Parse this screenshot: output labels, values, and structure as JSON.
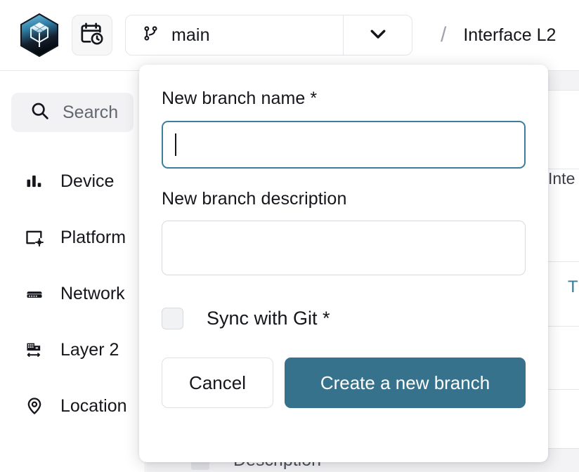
{
  "topbar": {
    "logo_icon": "app-logo-hexagon-cube",
    "history_button_icon": "calendar-clock-icon",
    "branch": {
      "icon": "git-branch-icon",
      "name": "main",
      "caret_icon": "chevron-down-icon"
    },
    "breadcrumb_separator": "/",
    "breadcrumb_title": "Interface L2"
  },
  "sidebar": {
    "search": {
      "icon": "search-icon",
      "placeholder": "Search"
    },
    "items": [
      {
        "label": "Device",
        "icon": "bar-chart-icon"
      },
      {
        "label": "Platform",
        "icon": "window-gear-icon"
      },
      {
        "label": "Network",
        "icon": "server-switch-icon"
      },
      {
        "label": "Layer 2",
        "icon": "layer2-switch-icon"
      },
      {
        "label": "Location",
        "icon": "map-pin-icon"
      }
    ]
  },
  "content": {
    "cell_text": "Inte",
    "link_text": "T",
    "table_header": {
      "select_all": "select-all-checkbox",
      "column": "Description"
    }
  },
  "modal": {
    "name_field": {
      "label": "New branch name *",
      "value": "",
      "placeholder": ""
    },
    "description_field": {
      "label": "New branch description",
      "value": "",
      "placeholder": ""
    },
    "sync_checkbox": {
      "label": "Sync with Git *",
      "checked": false
    },
    "cancel_label": "Cancel",
    "submit_label": "Create a new branch"
  },
  "colors": {
    "accent": "#36728c",
    "focus_border": "#3d7f9b",
    "link": "#3a7b95",
    "text": "#14161c",
    "muted": "#63676f"
  }
}
